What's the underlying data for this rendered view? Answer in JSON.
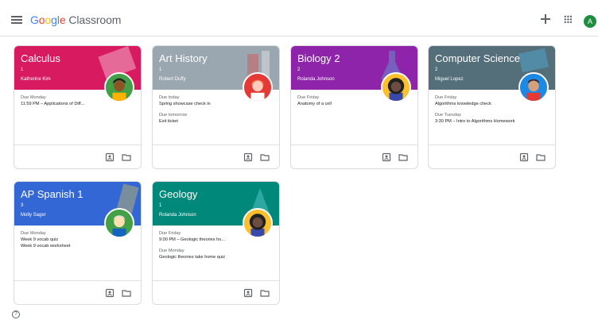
{
  "app": {
    "logo_google": [
      "G",
      "o",
      "o",
      "g",
      "l",
      "e"
    ],
    "logo_google_colors": [
      "#4285F4",
      "#EA4335",
      "#FBBC05",
      "#4285F4",
      "#34A853",
      "#EA4335"
    ],
    "logo_product": "Classroom",
    "account_initial": "A"
  },
  "icons": {
    "menu": "hamburger-menu-icon",
    "create": "plus-icon",
    "apps": "apps-grid-icon",
    "portfolio": "portfolio-icon",
    "folder": "folder-icon",
    "help": "help-icon"
  },
  "help_glyph": "?",
  "colors": {
    "calculus": "#d81b60",
    "art_history": "#9aa7b0",
    "biology": "#8e24aa",
    "computer_science": "#546e7a",
    "ap_spanish": "#3367d6",
    "geology": "#00897b"
  },
  "courses": [
    {
      "title": "Calculus",
      "section": "1",
      "teacher": "Katherine Kim",
      "assignments": [
        {
          "due": "Due Monday",
          "items": [
            "11:59 PM – Applications of Diff..."
          ]
        }
      ]
    },
    {
      "title": "Art History",
      "section": "1",
      "teacher": "Robert Duffy",
      "assignments": [
        {
          "due": "Due today",
          "items": [
            "Spring showcase check in"
          ]
        },
        {
          "due": "Due tomorrow",
          "items": [
            "Exit ticket"
          ]
        }
      ]
    },
    {
      "title": "Biology 2",
      "section": "2",
      "teacher": "Rolanda Johnson",
      "assignments": [
        {
          "due": "Due Friday",
          "items": [
            "Anatomy of a cell"
          ]
        }
      ]
    },
    {
      "title": "Computer Science",
      "section": "2",
      "teacher": "Miguel Lopez",
      "assignments": [
        {
          "due": "Due Friday",
          "items": [
            "Algorithms knowledge check"
          ]
        },
        {
          "due": "Due Tuesday",
          "items": [
            "3:30 PM – Intro to Algorithms Homework"
          ]
        }
      ]
    },
    {
      "title": "AP Spanish 1",
      "section": "3",
      "teacher": "Molly Sager",
      "assignments": [
        {
          "due": "Due Monday",
          "items": [
            "Week 9 vocab quiz",
            "Week 9 vocab worksheet"
          ]
        }
      ]
    },
    {
      "title": "Geology",
      "section": "1",
      "teacher": "Rolanda Johnson",
      "assignments": [
        {
          "due": "Due Friday",
          "items": [
            "9:00 PM – Geologic theories ho..."
          ]
        },
        {
          "due": "Due Monday",
          "items": [
            "Geologic theories take home quiz"
          ]
        }
      ]
    }
  ]
}
